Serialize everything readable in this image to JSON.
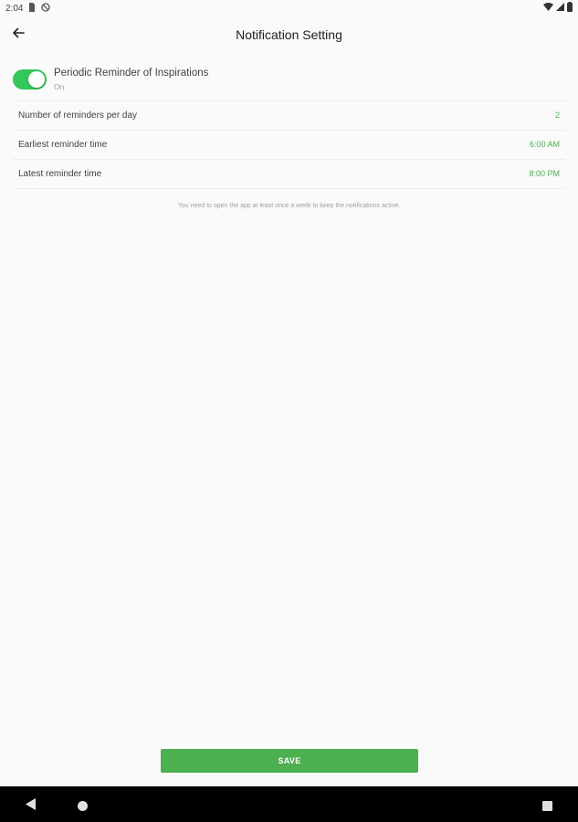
{
  "status_bar": {
    "time": "2:04",
    "icons": [
      "sim-card-icon",
      "no-disturb-icon",
      "wifi-icon",
      "signal-icon",
      "battery-icon"
    ]
  },
  "app_bar": {
    "title": "Notification Setting",
    "back_icon": "arrow-left-icon"
  },
  "reminder_toggle": {
    "title": "Periodic Reminder of Inspirations",
    "state_text": "On",
    "enabled": true
  },
  "settings": [
    {
      "label": "Number of reminders per day",
      "value": "2"
    },
    {
      "label": "Earliest reminder time",
      "value": "6:00 AM"
    },
    {
      "label": "Latest reminder time",
      "value": "8:00 PM"
    }
  ],
  "hint": "You need to open the app at least once a week to keep the notifications active.",
  "save_label": "SAVE",
  "colors": {
    "accent": "#4caf50",
    "switch_on": "#34c759",
    "background": "#fafafa",
    "nav_bar": "#000000"
  }
}
